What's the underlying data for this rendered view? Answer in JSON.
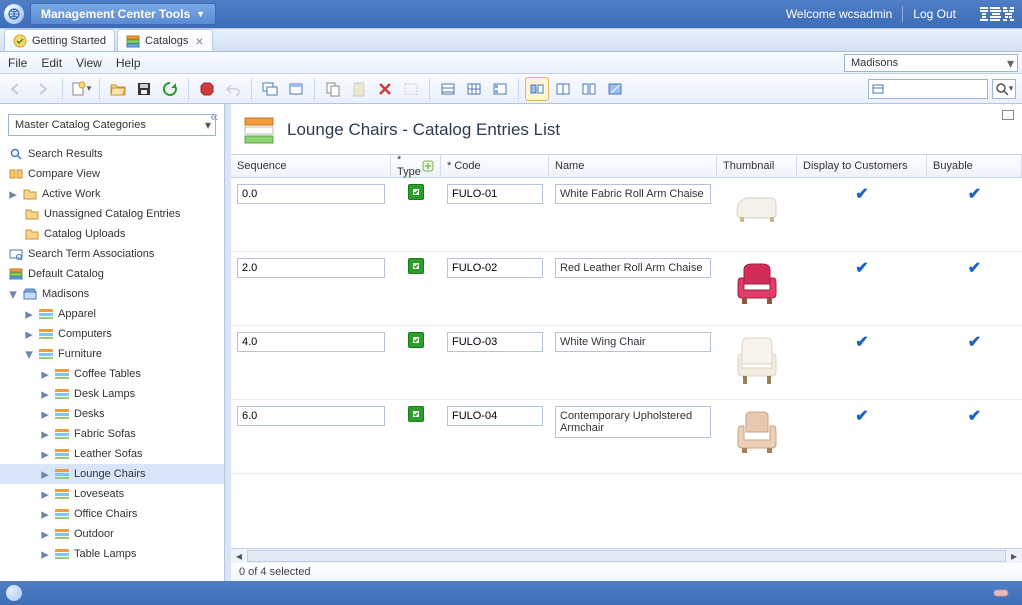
{
  "banner": {
    "title": "Management Center Tools",
    "welcome": "Welcome wcsadmin",
    "logout": "Log Out"
  },
  "tabs": {
    "gettingStarted": "Getting Started",
    "catalogs": "Catalogs"
  },
  "menus": {
    "file": "File",
    "edit": "Edit",
    "view": "View",
    "help": "Help"
  },
  "storeSelect": "Madisons",
  "leftPane": {
    "dropdown": "Master Catalog Categories",
    "nodes": {
      "searchResults": "Search Results",
      "compareView": "Compare View",
      "activeWork": "Active Work",
      "unassigned": "Unassigned Catalog Entries",
      "catalogUploads": "Catalog Uploads",
      "searchTerm": "Search Term Associations",
      "defaultCatalog": "Default Catalog",
      "madisons": "Madisons",
      "apparel": "Apparel",
      "computers": "Computers",
      "furniture": "Furniture",
      "coffeeTables": "Coffee Tables",
      "deskLamps": "Desk Lamps",
      "desks": "Desks",
      "fabricSofas": "Fabric Sofas",
      "leatherSofas": "Leather Sofas",
      "loungeChairs": "Lounge Chairs",
      "loveseats": "Loveseats",
      "officeChairs": "Office Chairs",
      "outdoor": "Outdoor",
      "tableLamps": "Table Lamps"
    }
  },
  "rightPane": {
    "title": "Lounge Chairs - Catalog Entries List",
    "cols": {
      "sequence": "Sequence",
      "type": "* Type",
      "code": "* Code",
      "name": "Name",
      "thumb": "Thumbnail",
      "display": "Display to Customers",
      "buyable": "Buyable"
    },
    "rows": [
      {
        "seq": "0.0",
        "code": "FULO-01",
        "name": "White Fabric Roll Arm Chaise",
        "thumb": "white-chaise",
        "disp": true,
        "buy": true
      },
      {
        "seq": "2.0",
        "code": "FULO-02",
        "name": "Red Leather Roll Arm Chaise",
        "thumb": "red-chair",
        "disp": true,
        "buy": true
      },
      {
        "seq": "4.0",
        "code": "FULO-03",
        "name": "White Wing Chair",
        "thumb": "wing-chair",
        "disp": true,
        "buy": true
      },
      {
        "seq": "6.0",
        "code": "FULO-04",
        "name": "Contemporary Upholstered Armchair",
        "thumb": "armchair",
        "disp": true,
        "buy": true
      }
    ],
    "status": "0 of 4 selected"
  }
}
